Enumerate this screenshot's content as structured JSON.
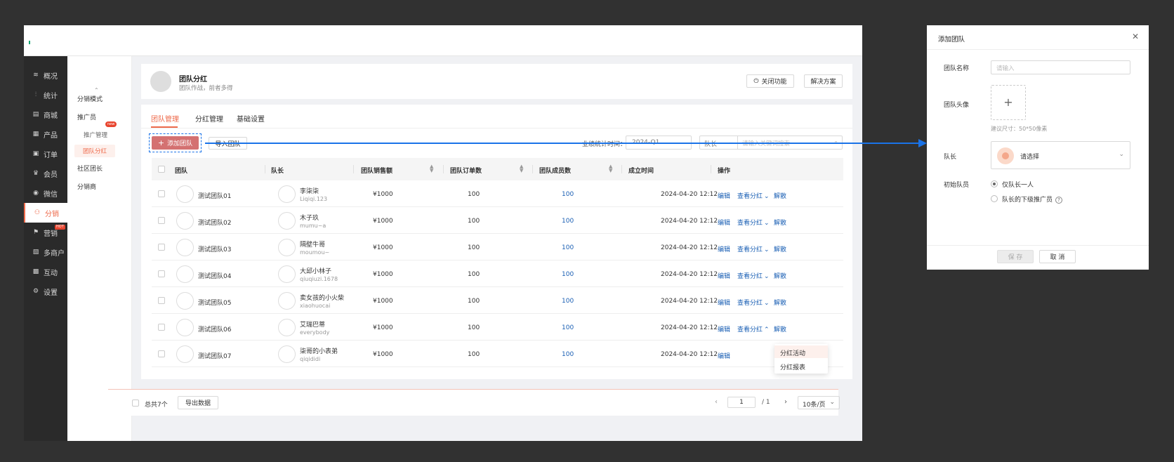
{
  "nav": [
    {
      "label": "概况",
      "icon": "layers-icon",
      "glyph": "≋"
    },
    {
      "label": "统计",
      "icon": "chart-icon",
      "glyph": "⫶"
    },
    {
      "label": "商城",
      "icon": "store-icon",
      "glyph": "▤"
    },
    {
      "label": "产品",
      "icon": "grid-icon",
      "glyph": "▦"
    },
    {
      "label": "订单",
      "icon": "order-icon",
      "glyph": "▣"
    },
    {
      "label": "会员",
      "icon": "crown-icon",
      "glyph": "♛"
    },
    {
      "label": "微信",
      "icon": "wechat-icon",
      "glyph": "◉"
    },
    {
      "label": "分销",
      "icon": "distribution-icon",
      "glyph": "⚇"
    },
    {
      "label": "营销",
      "icon": "flag-icon",
      "glyph": "⚑"
    },
    {
      "label": "多商户",
      "icon": "merchant-icon",
      "glyph": "▧"
    },
    {
      "label": "互动",
      "icon": "interact-icon",
      "glyph": "▩"
    },
    {
      "label": "设置",
      "icon": "gear-icon",
      "glyph": "⚙"
    }
  ],
  "nav_hot_badge": "HOT",
  "subnav": {
    "mode": "分销模式",
    "promoter": "推广员",
    "promoter_mgmt": "推广管理",
    "team_dividend": "团队分红",
    "new_badge": "new",
    "community": "社区团长",
    "distributor": "分销商"
  },
  "header": {
    "title": "团队分红",
    "subtitle": "团队作战，前者多得",
    "close_feature": "关闭功能",
    "solution": "解决方案"
  },
  "tabs": [
    "团队管理",
    "分红管理",
    "基础设置"
  ],
  "toolbar": {
    "add_team": "添加团队",
    "import_team": "导入团队",
    "stat_time_label": "业绩统计时间：",
    "date_value": "2024-Q1",
    "search_type": "队长",
    "search_placeholder": "请输入关键词搜索"
  },
  "columns": [
    "团队",
    "队长",
    "团队销售额",
    "团队订单数",
    "团队成员数",
    "成立时间",
    "操作"
  ],
  "rows": [
    {
      "team": "测试团队01",
      "leader": "李柒柒",
      "leader_id": "Liqiqi.123",
      "sales": "¥1000",
      "orders": "100",
      "members": "100",
      "time": "2024-04-20  12:12"
    },
    {
      "team": "测试团队02",
      "leader": "木子玖",
      "leader_id": "mumu~a",
      "sales": "¥1000",
      "orders": "100",
      "members": "100",
      "time": "2024-04-20  12:12"
    },
    {
      "team": "测试团队03",
      "leader": "隔壁牛哥",
      "leader_id": "moumou~",
      "sales": "¥1000",
      "orders": "100",
      "members": "100",
      "time": "2024-04-20  12:12"
    },
    {
      "team": "测试团队04",
      "leader": "大邱小林子",
      "leader_id": "qiuqiuzi.1678",
      "sales": "¥1000",
      "orders": "100",
      "members": "100",
      "time": "2024-04-20  12:12"
    },
    {
      "team": "测试团队05",
      "leader": "卖女孩的小火柴",
      "leader_id": "xiaohuocai",
      "sales": "¥1000",
      "orders": "100",
      "members": "100",
      "time": "2024-04-20  12:12"
    },
    {
      "team": "测试团队06",
      "leader": "艾瑞巴蒂",
      "leader_id": "everybody",
      "sales": "¥1000",
      "orders": "100",
      "members": "100",
      "time": "2024-04-20  12:12"
    },
    {
      "team": "测试团队07",
      "leader": "柒哥的小表弟",
      "leader_id": "qiqididi",
      "sales": "¥1000",
      "orders": "100",
      "members": "100",
      "time": "2024-04-20  12:12"
    }
  ],
  "actions": {
    "edit": "编辑",
    "view": "查看分红",
    "dissolve": "解散"
  },
  "dropdown": {
    "activity": "分红活动",
    "report": "分红报表"
  },
  "footer": {
    "total": "总共7个",
    "export": "导出数据",
    "page": "1",
    "page_total": "/  1",
    "page_size": "10条/页"
  },
  "dialog": {
    "title": "添加团队",
    "name_label": "团队名称",
    "name_placeholder": "请输入",
    "avatar_label": "团队头像",
    "avatar_hint": "建议尺寸：50*50像素",
    "leader_label": "队长",
    "leader_placeholder": "请选择",
    "initial_label": "初始队员",
    "option_only": "仅队长一人",
    "option_sub": "队长的下级推广员",
    "save": "保 存",
    "cancel": "取 消"
  }
}
